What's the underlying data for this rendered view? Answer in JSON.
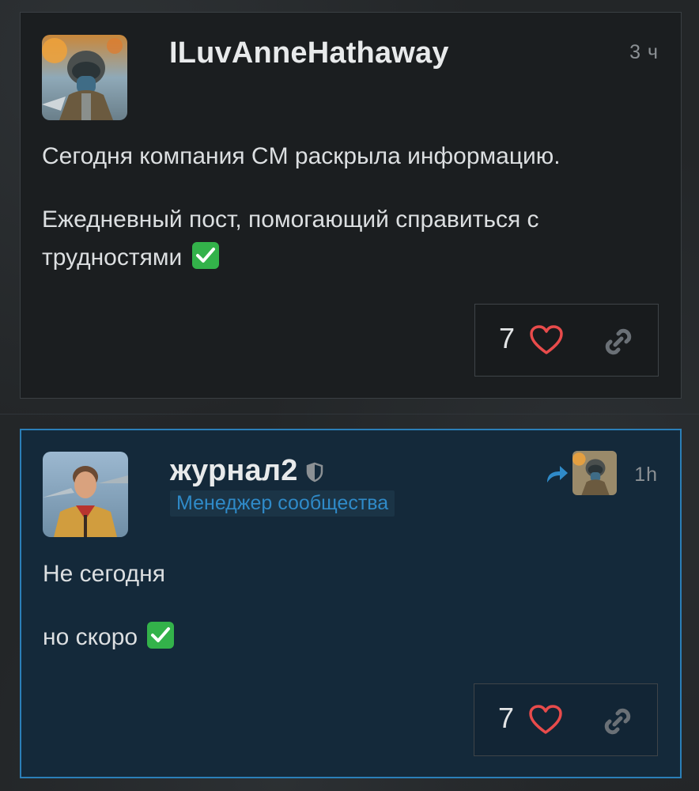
{
  "posts": [
    {
      "username": "ILuvAnneHathaway",
      "time": "3 ч",
      "paragraphs": [
        "Сегодня компания CM раскрыла информацию.",
        "Ежедневный пост, помогающий справиться с трудностями"
      ],
      "likes": "7"
    },
    {
      "username": "журнал2",
      "role": "Менеджер сообщества",
      "time": "1h",
      "paragraphs": [
        "Не сегодня",
        "но скоро"
      ],
      "likes": "7"
    }
  ],
  "icons": {
    "like": "heart-icon",
    "share": "link-icon",
    "verified": "shield-icon",
    "reply": "reply-arrow-icon",
    "emoji": "check-mark-emoji"
  },
  "colors": {
    "heart": "#e84b4b",
    "accent": "#2f8ac8",
    "check": "#33b24a"
  }
}
